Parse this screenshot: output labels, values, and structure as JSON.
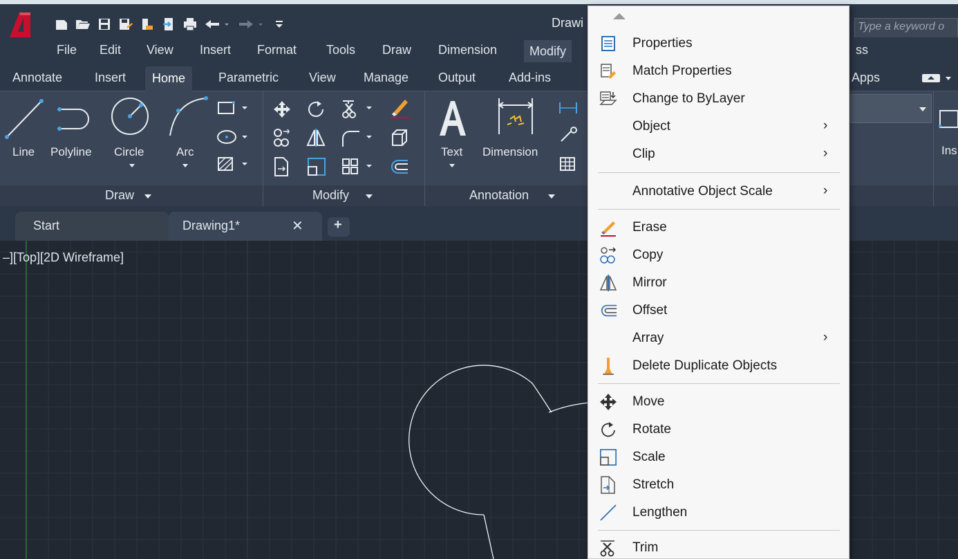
{
  "title_bar": {
    "document_title": "Drawi",
    "search_placeholder": "Type a keyword o"
  },
  "menu_bar": [
    "File",
    "Edit",
    "View",
    "Insert",
    "Format",
    "Tools",
    "Draw",
    "Dimension",
    "Modify",
    "ss"
  ],
  "ribbon_tabs": [
    "Annotate",
    "Insert",
    "Home",
    "Parametric",
    "View",
    "Manage",
    "Output",
    "Add-ins",
    "Apps"
  ],
  "active_ribbon_tab": "Home",
  "ribbon": {
    "draw_tools": {
      "line": "Line",
      "polyline": "Polyline",
      "circle": "Circle",
      "arc": "Arc"
    },
    "annotation_tools": {
      "text": "Text",
      "dimension": "Dimension"
    },
    "cut_label": "Ins",
    "panels": {
      "draw": "Draw",
      "modify": "Modify",
      "annotation": "Annotation"
    }
  },
  "document_tabs": {
    "start": "Start",
    "drawing": "Drawing1*",
    "close_symbol": "✕",
    "new_symbol": "+"
  },
  "viewport_label": "–][Top][2D Wireframe]",
  "context_menu": {
    "items": [
      {
        "label": "Properties",
        "icon": "properties-icon"
      },
      {
        "label": "Match Properties",
        "icon": "match-properties-icon"
      },
      {
        "label": "Change to ByLayer",
        "icon": "change-to-bylayer-icon"
      },
      {
        "label": "Object",
        "submenu": true
      },
      {
        "label": "Clip",
        "submenu": true
      },
      {
        "label": "Annotative Object Scale",
        "submenu": true
      },
      {
        "label": "Erase",
        "icon": "erase-icon"
      },
      {
        "label": "Copy",
        "icon": "copy-icon"
      },
      {
        "label": "Mirror",
        "icon": "mirror-icon"
      },
      {
        "label": "Offset",
        "icon": "offset-icon"
      },
      {
        "label": "Array",
        "submenu": true
      },
      {
        "label": "Delete Duplicate Objects",
        "icon": "delete-duplicates-icon"
      },
      {
        "label": "Move",
        "icon": "move-icon"
      },
      {
        "label": "Rotate",
        "icon": "rotate-icon"
      },
      {
        "label": "Scale",
        "icon": "scale-icon"
      },
      {
        "label": "Stretch",
        "icon": "stretch-icon"
      },
      {
        "label": "Lengthen",
        "icon": "lengthen-icon"
      },
      {
        "label": "Trim",
        "icon": "trim-icon"
      }
    ],
    "submenu_arrow": "›"
  },
  "colors": {
    "title_bar_bg": "#2c3747",
    "ribbon_bg": "#3a4557",
    "canvas_bg": "#212832",
    "menu_bg": "#f7f7f7",
    "accent_blue": "#4aa3df",
    "erase_orange": "#f0a030",
    "autocad_red": "#c8102e"
  }
}
